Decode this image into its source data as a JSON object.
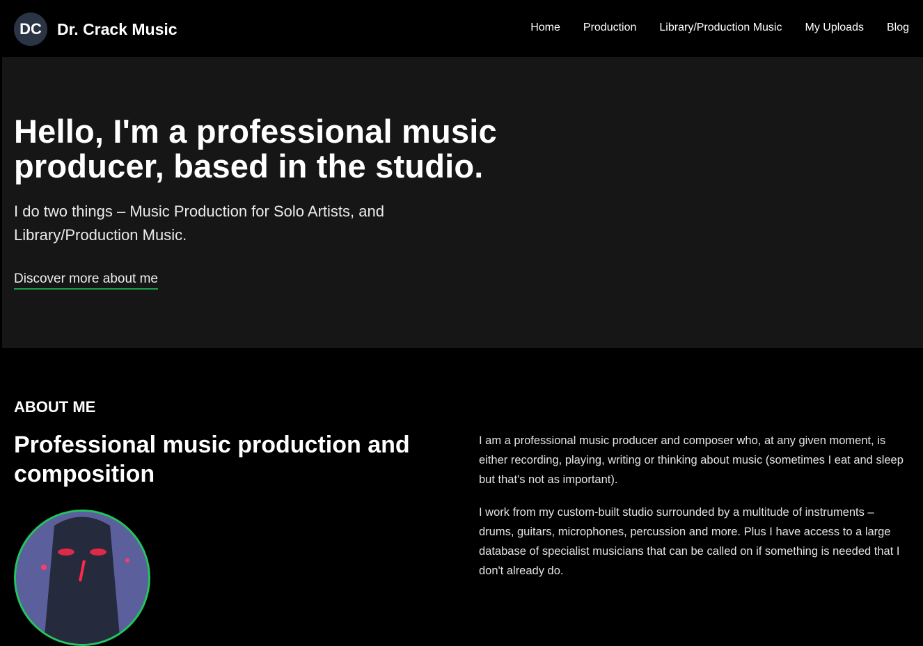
{
  "nav": {
    "logo_initials": "DC",
    "site_name": "Dr. Crack Music",
    "items": [
      {
        "label": "Home"
      },
      {
        "label": "Production"
      },
      {
        "label": "Library/Production Music"
      },
      {
        "label": "My Uploads"
      },
      {
        "label": "Blog"
      }
    ]
  },
  "hero": {
    "title": "Hello, I'm a professional music producer, based in the studio.",
    "subtitle": "I do two things – Music Production for Solo Artists, and Library/Production Music.",
    "cta": "Discover more about me"
  },
  "about": {
    "kicker": "ABOUT ME",
    "title": "Professional music production and composition",
    "paragraphs": [
      "I am a professional music producer and composer who, at any given moment, is either recording, playing, writing or thinking about music (sometimes I eat and sleep but that's not as important).",
      "I work from my custom-built studio surrounded by a multitude of instruments – drums, guitars, microphones, percussion and more. Plus I have access to a large database of specialist musicians that can be called on if something is needed that I don't already do."
    ]
  },
  "colors": {
    "accent": "#22c55e",
    "hero_bg": "#161616",
    "logo_badge": "#2b3445"
  }
}
